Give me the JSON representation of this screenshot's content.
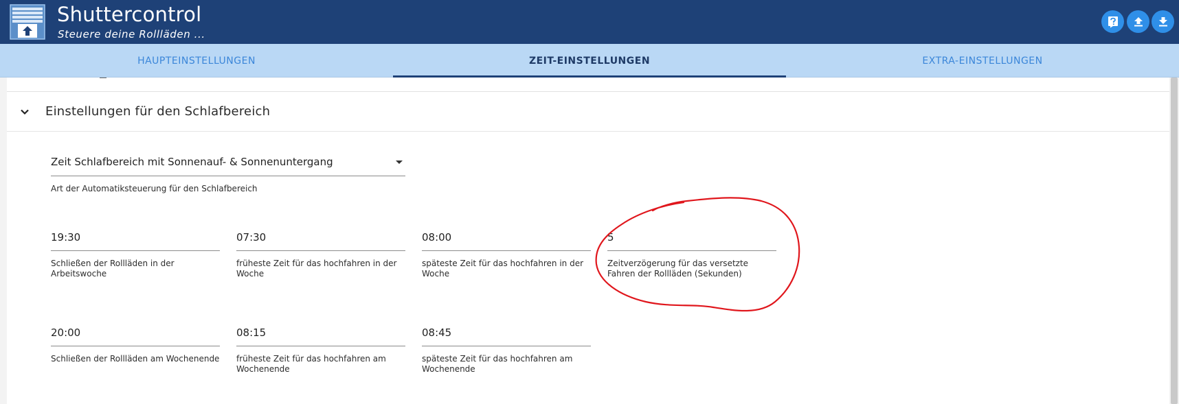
{
  "header": {
    "title": "Shuttercontrol",
    "subtitle": "Steuere deine Rollläden ...",
    "logo_icon": "window-shutter-up-icon",
    "buttons": [
      {
        "icon": "help-icon"
      },
      {
        "icon": "upload-icon"
      },
      {
        "icon": "download-icon"
      }
    ]
  },
  "tabs": [
    {
      "label": "HAUPTEINSTELLUNGEN",
      "active": false
    },
    {
      "label": "ZEIT-EINSTELLUNGEN",
      "active": true
    },
    {
      "label": "EXTRA-EINSTELLUNGEN",
      "active": false
    }
  ],
  "section": {
    "title": "Einstellungen für den Schlafbereich",
    "expanded": true,
    "mode_select": {
      "value": "Zeit Schlafbereich mit Sonnenauf- & Sonnenuntergang",
      "helper": "Art der Automatiksteuerung für den Schlafbereich"
    },
    "fields": [
      {
        "value": "19:30",
        "label": "Schließen der Rollläden in der Arbeitswoche"
      },
      {
        "value": "07:30",
        "label": "früheste Zeit für das hochfahren in der Woche"
      },
      {
        "value": "08:00",
        "label": "späteste Zeit für das hochfahren in der Woche"
      },
      {
        "value": "5",
        "label": "Zeitverzögerung für das versetzte Fahren der Rollläden (Sekunden)"
      },
      {
        "value": "20:00",
        "label": "Schließen der Rollläden am Wochenende"
      },
      {
        "value": "08:15",
        "label": "früheste Zeit für das hochfahren am Wochenende"
      },
      {
        "value": "08:45",
        "label": "späteste Zeit für das hochfahren am Wochenende"
      }
    ]
  },
  "colors": {
    "header_bg": "#1e4177",
    "tabs_bg": "#bad8f5",
    "tab_inactive": "#3b86d9",
    "tab_active": "#1e3a66",
    "header_button": "#2f8fe8",
    "annotation": "#e0161c"
  }
}
